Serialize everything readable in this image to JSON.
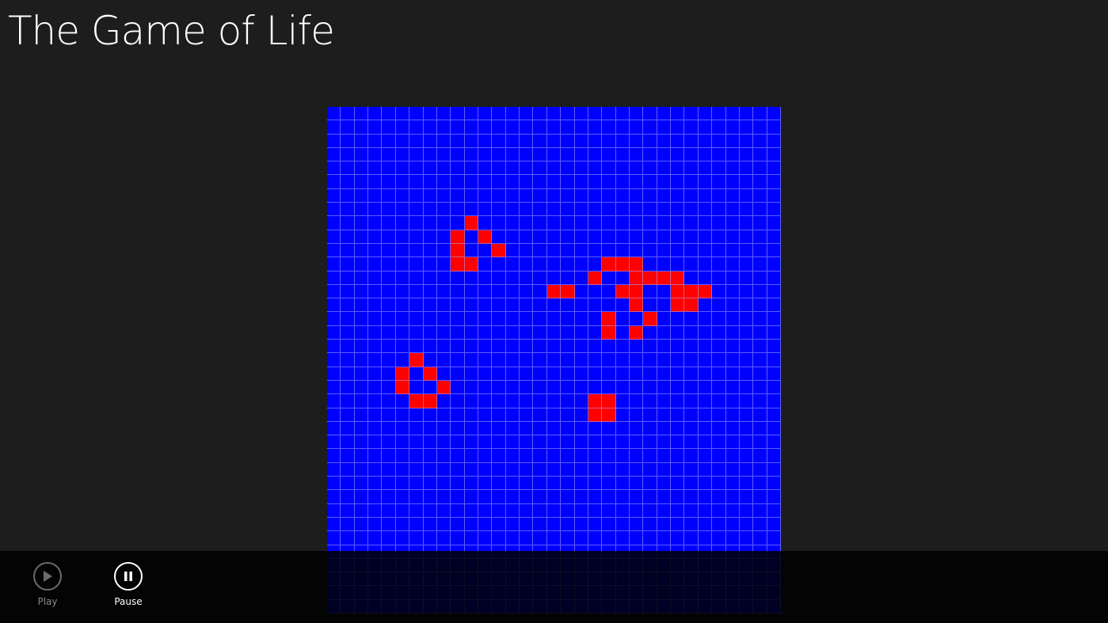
{
  "app": {
    "title": "The Game of Life"
  },
  "board": {
    "columns": 33,
    "rows": 37,
    "dead_color": "#0000ff",
    "alive_color": "#ff0000",
    "grid_line_color": "#aaaaff",
    "alive_cells": [
      [
        8,
        10
      ],
      [
        9,
        9
      ],
      [
        9,
        11
      ],
      [
        10,
        9
      ],
      [
        10,
        12
      ],
      [
        11,
        9
      ],
      [
        11,
        10
      ],
      [
        11,
        20
      ],
      [
        11,
        21
      ],
      [
        11,
        22
      ],
      [
        12,
        19
      ],
      [
        12,
        22
      ],
      [
        12,
        23
      ],
      [
        12,
        24
      ],
      [
        12,
        25
      ],
      [
        13,
        16
      ],
      [
        13,
        17
      ],
      [
        13,
        21
      ],
      [
        13,
        22
      ],
      [
        13,
        25
      ],
      [
        13,
        26
      ],
      [
        13,
        27
      ],
      [
        14,
        22
      ],
      [
        14,
        25
      ],
      [
        14,
        26
      ],
      [
        15,
        20
      ],
      [
        15,
        23
      ],
      [
        16,
        20
      ],
      [
        16,
        22
      ],
      [
        18,
        6
      ],
      [
        19,
        5
      ],
      [
        19,
        7
      ],
      [
        20,
        5
      ],
      [
        20,
        8
      ],
      [
        21,
        6
      ],
      [
        21,
        7
      ],
      [
        21,
        19
      ],
      [
        21,
        20
      ],
      [
        22,
        19
      ],
      [
        22,
        20
      ]
    ]
  },
  "app_bar": {
    "play_label": "Play",
    "pause_label": "Pause",
    "active_color": "#ffffff",
    "disabled_color": "#8a8a8a"
  }
}
